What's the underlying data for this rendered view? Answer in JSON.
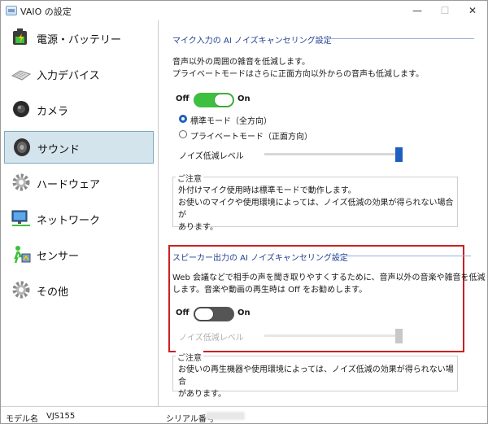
{
  "window": {
    "title": "VAIO の設定",
    "minimize": "—",
    "maximize": "☐",
    "close": "✕"
  },
  "sidebar": {
    "items": [
      {
        "label": "電源・バッテリー",
        "icon": "battery-icon",
        "selected": false
      },
      {
        "label": "入力デバイス",
        "icon": "keyboard-icon",
        "selected": false
      },
      {
        "label": "カメラ",
        "icon": "camera-icon",
        "selected": false
      },
      {
        "label": "サウンド",
        "icon": "speaker-icon",
        "selected": true
      },
      {
        "label": "ハードウェア",
        "icon": "gear-icon",
        "selected": false
      },
      {
        "label": "ネットワーク",
        "icon": "network-icon",
        "selected": false
      },
      {
        "label": "センサー",
        "icon": "sensor-icon",
        "selected": false
      },
      {
        "label": "その他",
        "icon": "gear-icon",
        "selected": false
      }
    ]
  },
  "mic_section": {
    "title": "マイク入力の AI ノイズキャンセリング設定",
    "desc_line1": "音声以外の周囲の雑音を低減します。",
    "desc_line2": "プライベートモードはさらに正面方向以外からの音声も低減します。",
    "toggle": {
      "off_label": "Off",
      "on_label": "On",
      "state": "on"
    },
    "radio_standard": {
      "label": "標準モード（全方向）",
      "checked": true
    },
    "radio_private": {
      "label": "プライベートモード（正面方向）",
      "checked": false
    },
    "slider": {
      "label": "ノイズ低減レベル",
      "level": 1.0,
      "enabled": true
    },
    "note": {
      "title": "ご注意",
      "line1": "外付けマイク使用時は標準モードで動作します。",
      "line2": "お使いのマイクや使用環境によっては、ノイズ低減の効果が得られない場合が",
      "line3": "あります。"
    }
  },
  "speaker_section": {
    "title": "スピーカー出力の AI ノイズキャンセリング設定",
    "desc_line1": "Web 会議などで相手の声を聞き取りやすくするために、音声以外の音楽や雑音を低減",
    "desc_line2": "します。音楽や動画の再生時は Off をお勧めします。",
    "toggle": {
      "off_label": "Off",
      "on_label": "On",
      "state": "off"
    },
    "slider": {
      "label": "ノイズ低減レベル",
      "level": 1.0,
      "enabled": false
    },
    "note": {
      "title": "ご注意",
      "line1": "お使いの再生機器や使用環境によっては、ノイズ低減の効果が得られない場合",
      "line2": "があります。"
    }
  },
  "statusbar": {
    "model_label": "モデル名",
    "model_value": "VJS155",
    "serial_label": "シリアル番号"
  },
  "colors": {
    "accent": "#1f5fbf",
    "toggle_on": "#3fbf3f",
    "toggle_off": "#555555",
    "selected_bg": "#d4e4ec",
    "highlight": "#cc2020"
  }
}
